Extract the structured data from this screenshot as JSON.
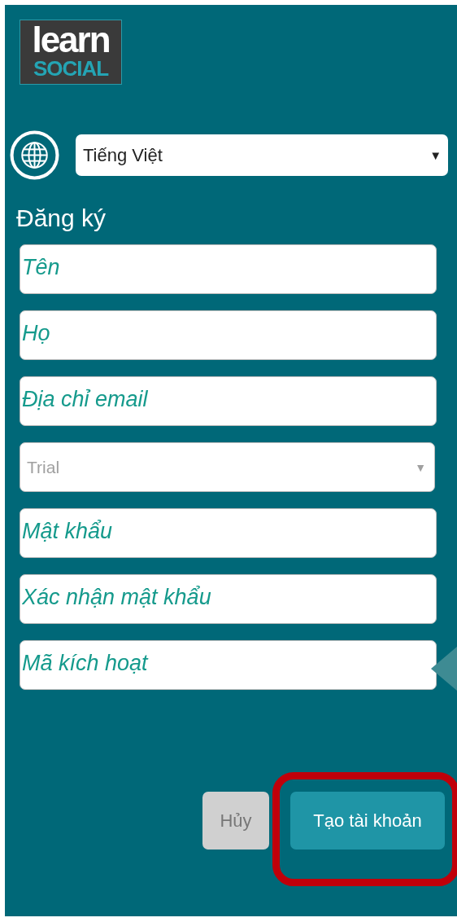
{
  "logo": {
    "line_1": "learn",
    "line_2": "SOCIAL"
  },
  "language": {
    "value": "Tiếng Việt",
    "caret": "▼"
  },
  "heading": "Đăng ký",
  "fields": [
    {
      "kind": "input",
      "placeholder": "Tên"
    },
    {
      "kind": "input",
      "placeholder": "Họ"
    },
    {
      "kind": "input",
      "placeholder": "Địa chỉ email"
    },
    {
      "kind": "select",
      "placeholder": "Trial",
      "caret": "▼"
    },
    {
      "kind": "input",
      "placeholder": "Mật khẩu"
    },
    {
      "kind": "input",
      "placeholder": "Xác nhận mật khẩu"
    },
    {
      "kind": "input",
      "placeholder": "Mã kích hoạt"
    }
  ],
  "buttons": [
    {
      "kind": "cancel",
      "label": "Hủy"
    },
    {
      "kind": "primary",
      "label": "Tạo tài khoản",
      "highlighted": true
    }
  ]
}
